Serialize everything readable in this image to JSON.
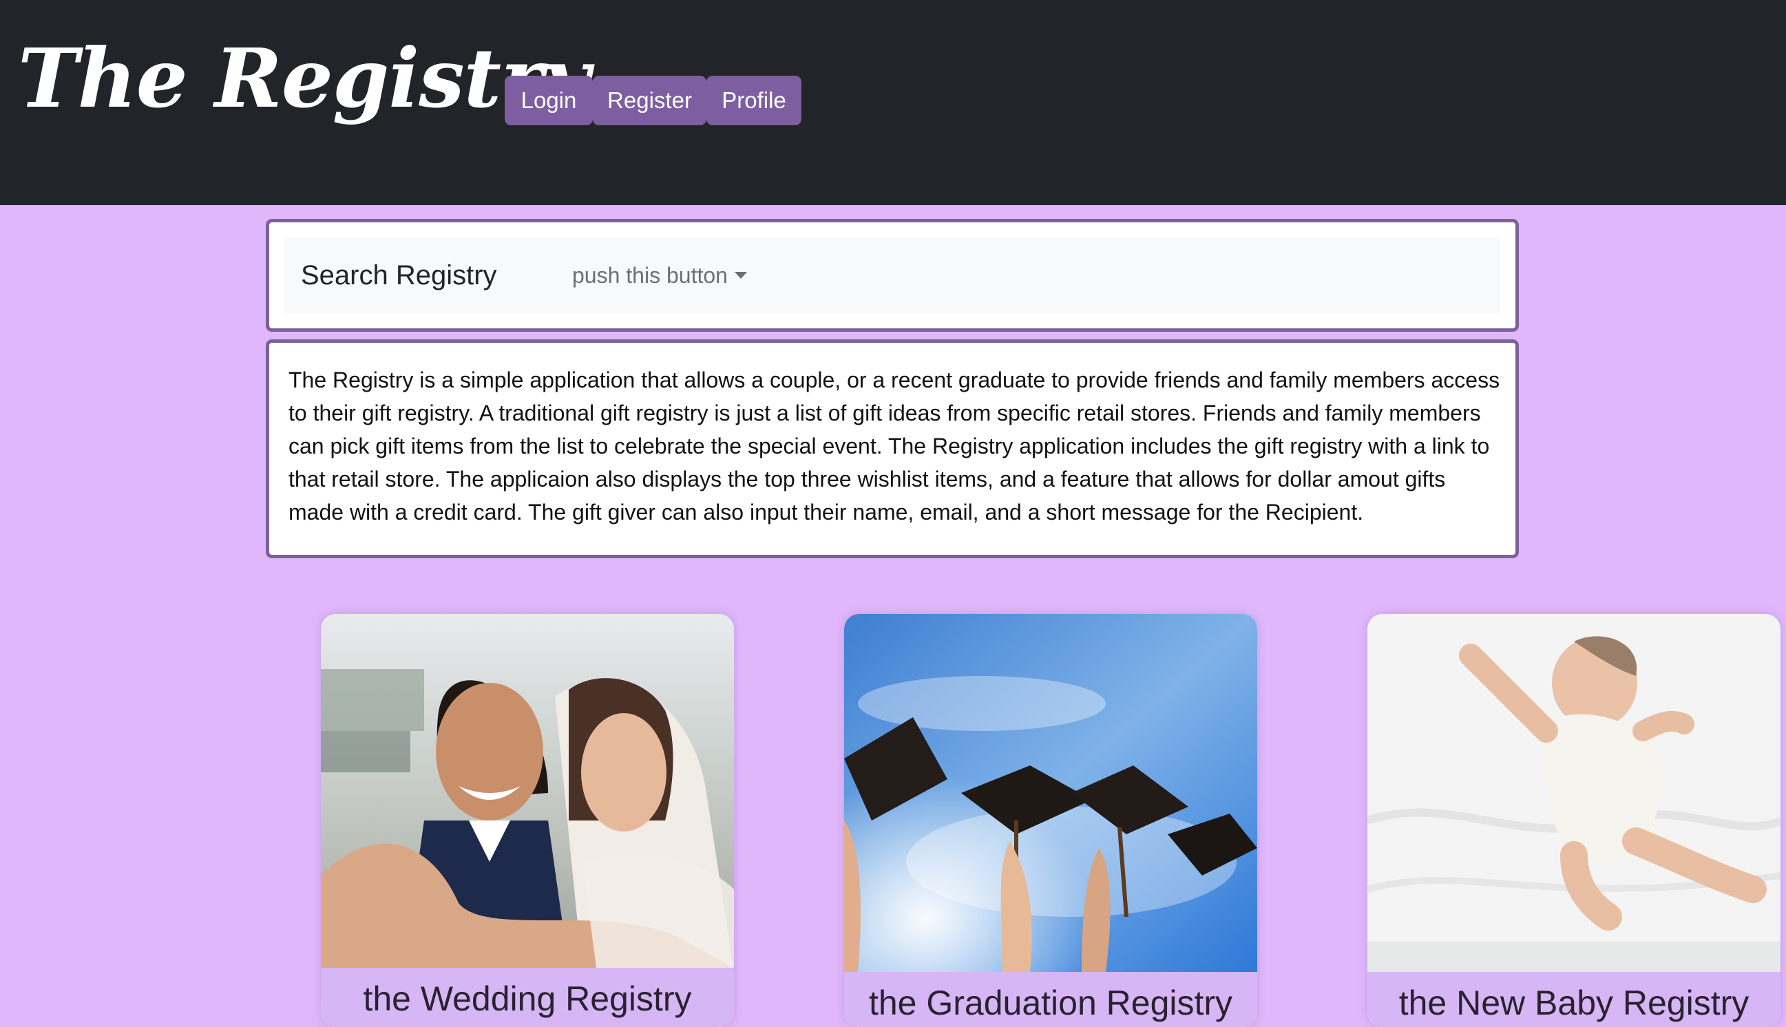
{
  "header": {
    "brand": "The Registry",
    "nav": [
      "Login",
      "Register",
      "Profile"
    ]
  },
  "search": {
    "title": "Search Registry",
    "dropdown_label": "push this button"
  },
  "description": "The Registry is a simple application that allows a couple, or a recent graduate to provide friends and family members access to their gift registry. A traditional gift registry is just a list of gift ideas from specific retail stores. Friends and family members can pick gift items from the list to celebrate the special event. The Registry application includes the gift registry with a link to that retail store. The applicaion also displays the top three wishlist items, and a feature that allows for dollar amout gifts made with a credit card. The gift giver can also input their name, email, and a short message for the Recipient.",
  "cards": [
    {
      "label": "the Wedding Registry"
    },
    {
      "label": "the Graduation Registry"
    },
    {
      "label": "the New Baby Registry"
    }
  ],
  "colors": {
    "page_background": "#e0b7fb",
    "header_background": "#212429",
    "nav_button": "#7d5ea0",
    "panel_border": "#7b6199"
  }
}
